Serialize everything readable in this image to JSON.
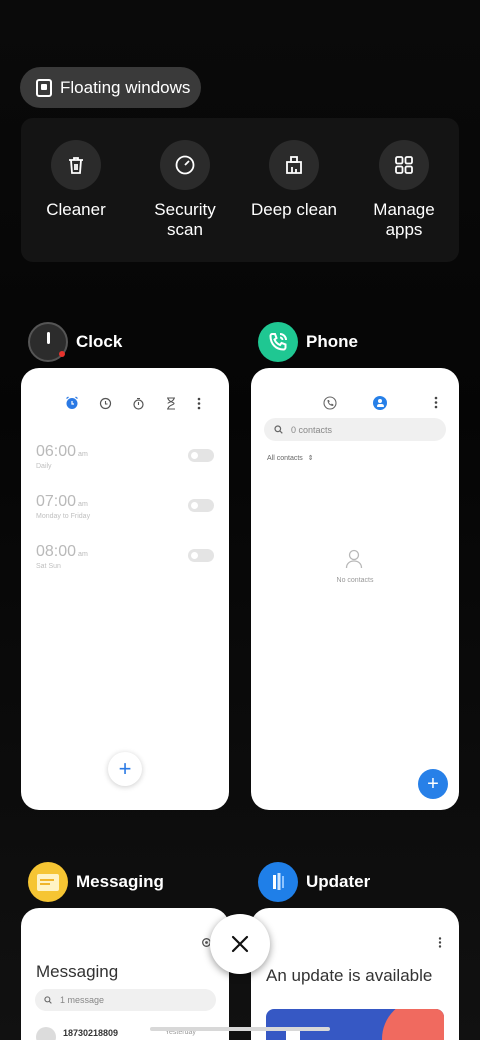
{
  "floating": {
    "label": "Floating windows"
  },
  "tools": [
    {
      "label_line1": "Cleaner",
      "label_line2": "",
      "icon": "trash-icon"
    },
    {
      "label_line1": "Security",
      "label_line2": "scan",
      "icon": "security-scan-icon"
    },
    {
      "label_line1": "Deep clean",
      "label_line2": "",
      "icon": "deep-clean-icon"
    },
    {
      "label_line1": "Manage",
      "label_line2": "apps",
      "icon": "grid-icon"
    }
  ],
  "apps": {
    "clock": {
      "name": "Clock",
      "alarms": [
        {
          "time": "06:00",
          "ampm": "am",
          "sub": "Daily"
        },
        {
          "time": "07:00",
          "ampm": "am",
          "sub": "Monday to Friday"
        },
        {
          "time": "08:00",
          "ampm": "am",
          "sub": "Sat Sun"
        }
      ],
      "add": "+"
    },
    "phone": {
      "name": "Phone",
      "search_placeholder": "0 contacts",
      "filter": "All contacts",
      "empty": "No contacts",
      "add": "+"
    },
    "messaging": {
      "name": "Messaging",
      "title": "Messaging",
      "search": "1 message",
      "sender": "18730218809",
      "time": "Yesterday"
    },
    "updater": {
      "name": "Updater",
      "title": "An update is available"
    }
  },
  "close": {
    "label": "×"
  },
  "colors": {
    "phone_icon_bg": "#1fc792",
    "messaging_icon_bg": "#f6c533",
    "updater_icon_bg": "#1f7fe8",
    "accent_blue": "#2780e8"
  }
}
